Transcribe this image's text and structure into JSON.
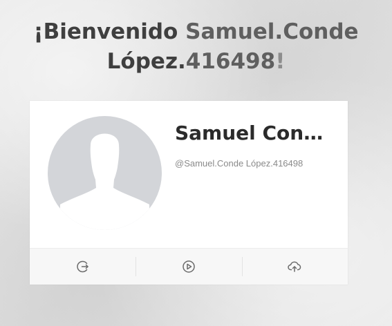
{
  "welcome": {
    "greeting": "¡Bienvenido",
    "name_part1": "Samuel.Conde",
    "name_part2": "López.",
    "name_number": "416498",
    "exclaim": "!"
  },
  "profile": {
    "display_name": "Samuel Cond...",
    "handle": "@Samuel.Conde López.416498",
    "avatar": "default-user-silhouette"
  },
  "actions": [
    {
      "name": "logout",
      "icon": "logout-icon"
    },
    {
      "name": "play",
      "icon": "play-circle-icon"
    },
    {
      "name": "upload",
      "icon": "cloud-upload-icon"
    }
  ],
  "colors": {
    "heading_dark": "#3f3f3f",
    "heading_light": "#8d8d8d",
    "avatar_bg": "#d3d5d9",
    "icon": "#6a6a6a"
  }
}
